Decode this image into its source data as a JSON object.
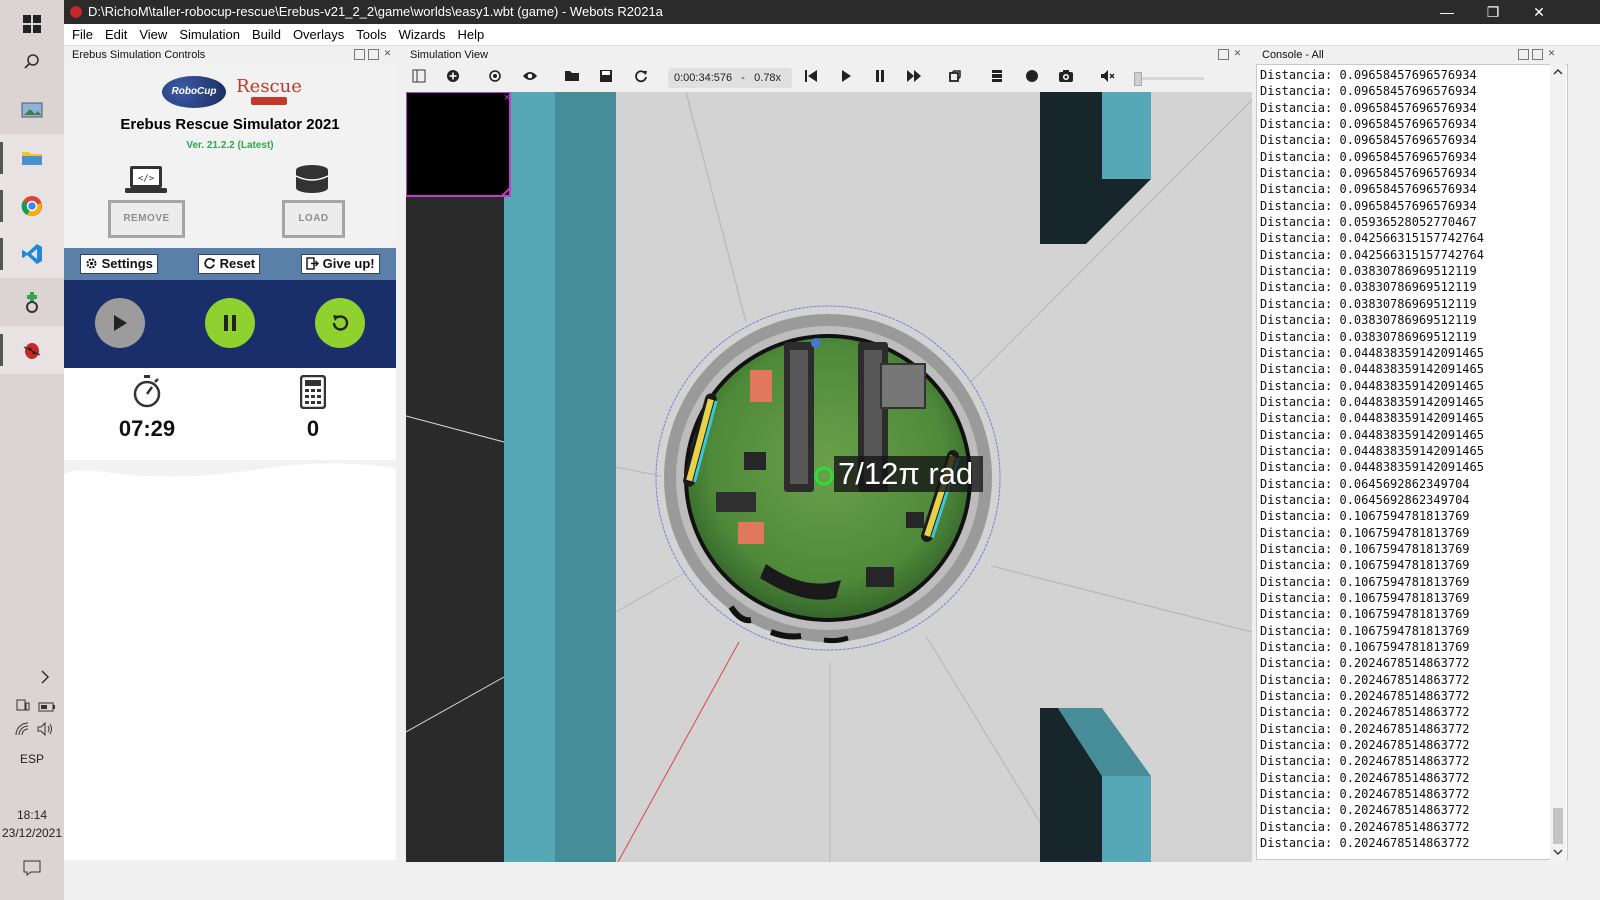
{
  "window": {
    "title": "D:\\RichoM\\taller-robocup-rescue\\Erebus-v21_2_2\\game\\worlds\\easy1.wbt (game) - Webots R2021a",
    "minimize": "—",
    "maximize": "❐",
    "close": "✕"
  },
  "menu": [
    "File",
    "Edit",
    "View",
    "Simulation",
    "Build",
    "Overlays",
    "Tools",
    "Wizards",
    "Help"
  ],
  "taskbar": {
    "language": "ESP",
    "time": "18:14",
    "date": "23/12/2021"
  },
  "panels": {
    "left_title": "Erebus Simulation Controls",
    "sim_title": "Simulation View",
    "console_title": "Console - All"
  },
  "erebus": {
    "robocup_logo": "RoboCup Junior",
    "rescue_logo": "Rescue",
    "title": "Erebus Rescue Simulator 2021",
    "version": "Ver. 21.2.2 (Latest)",
    "remove_label": "REMOVE",
    "load_label": "LOAD",
    "settings_label": "Settings",
    "reset_label": "Reset",
    "giveup_label": "Give up!",
    "timer": "07:29",
    "score": "0"
  },
  "sim": {
    "time": "0:00:34:576",
    "separator": "-",
    "speed": "0.78x",
    "overlay_label": "7/12π rad"
  },
  "console": {
    "lines": [
      "Distancia: 0.09658457696576934",
      "Distancia: 0.09658457696576934",
      "Distancia: 0.09658457696576934",
      "Distancia: 0.09658457696576934",
      "Distancia: 0.09658457696576934",
      "Distancia: 0.09658457696576934",
      "Distancia: 0.09658457696576934",
      "Distancia: 0.09658457696576934",
      "Distancia: 0.09658457696576934",
      "Distancia: 0.05936528052770467",
      "Distancia: 0.042566315157742764",
      "Distancia: 0.042566315157742764",
      "Distancia: 0.03830786969512119",
      "Distancia: 0.03830786969512119",
      "Distancia: 0.03830786969512119",
      "Distancia: 0.03830786969512119",
      "Distancia: 0.03830786969512119",
      "Distancia: 0.044838359142091465",
      "Distancia: 0.044838359142091465",
      "Distancia: 0.044838359142091465",
      "Distancia: 0.044838359142091465",
      "Distancia: 0.044838359142091465",
      "Distancia: 0.044838359142091465",
      "Distancia: 0.044838359142091465",
      "Distancia: 0.044838359142091465",
      "Distancia: 0.0645692862349704",
      "Distancia: 0.0645692862349704",
      "Distancia: 0.1067594781813769",
      "Distancia: 0.1067594781813769",
      "Distancia: 0.1067594781813769",
      "Distancia: 0.1067594781813769",
      "Distancia: 0.1067594781813769",
      "Distancia: 0.1067594781813769",
      "Distancia: 0.1067594781813769",
      "Distancia: 0.1067594781813769",
      "Distancia: 0.1067594781813769",
      "Distancia: 0.2024678514863772",
      "Distancia: 0.2024678514863772",
      "Distancia: 0.2024678514863772",
      "Distancia: 0.2024678514863772",
      "Distancia: 0.2024678514863772",
      "Distancia: 0.2024678514863772",
      "Distancia: 0.2024678514863772",
      "Distancia: 0.2024678514863772",
      "Distancia: 0.2024678514863772",
      "Distancia: 0.2024678514863772",
      "Distancia: 0.2024678514863772",
      "Distancia: 0.2024678514863772"
    ]
  },
  "colors": {
    "accent_green": "#8fd12e",
    "button_bar": "#5a7fa8",
    "play_panel": "#1a2e6a",
    "wall_teal": "#56a8b6",
    "wall_dark_teal": "#468d97"
  }
}
